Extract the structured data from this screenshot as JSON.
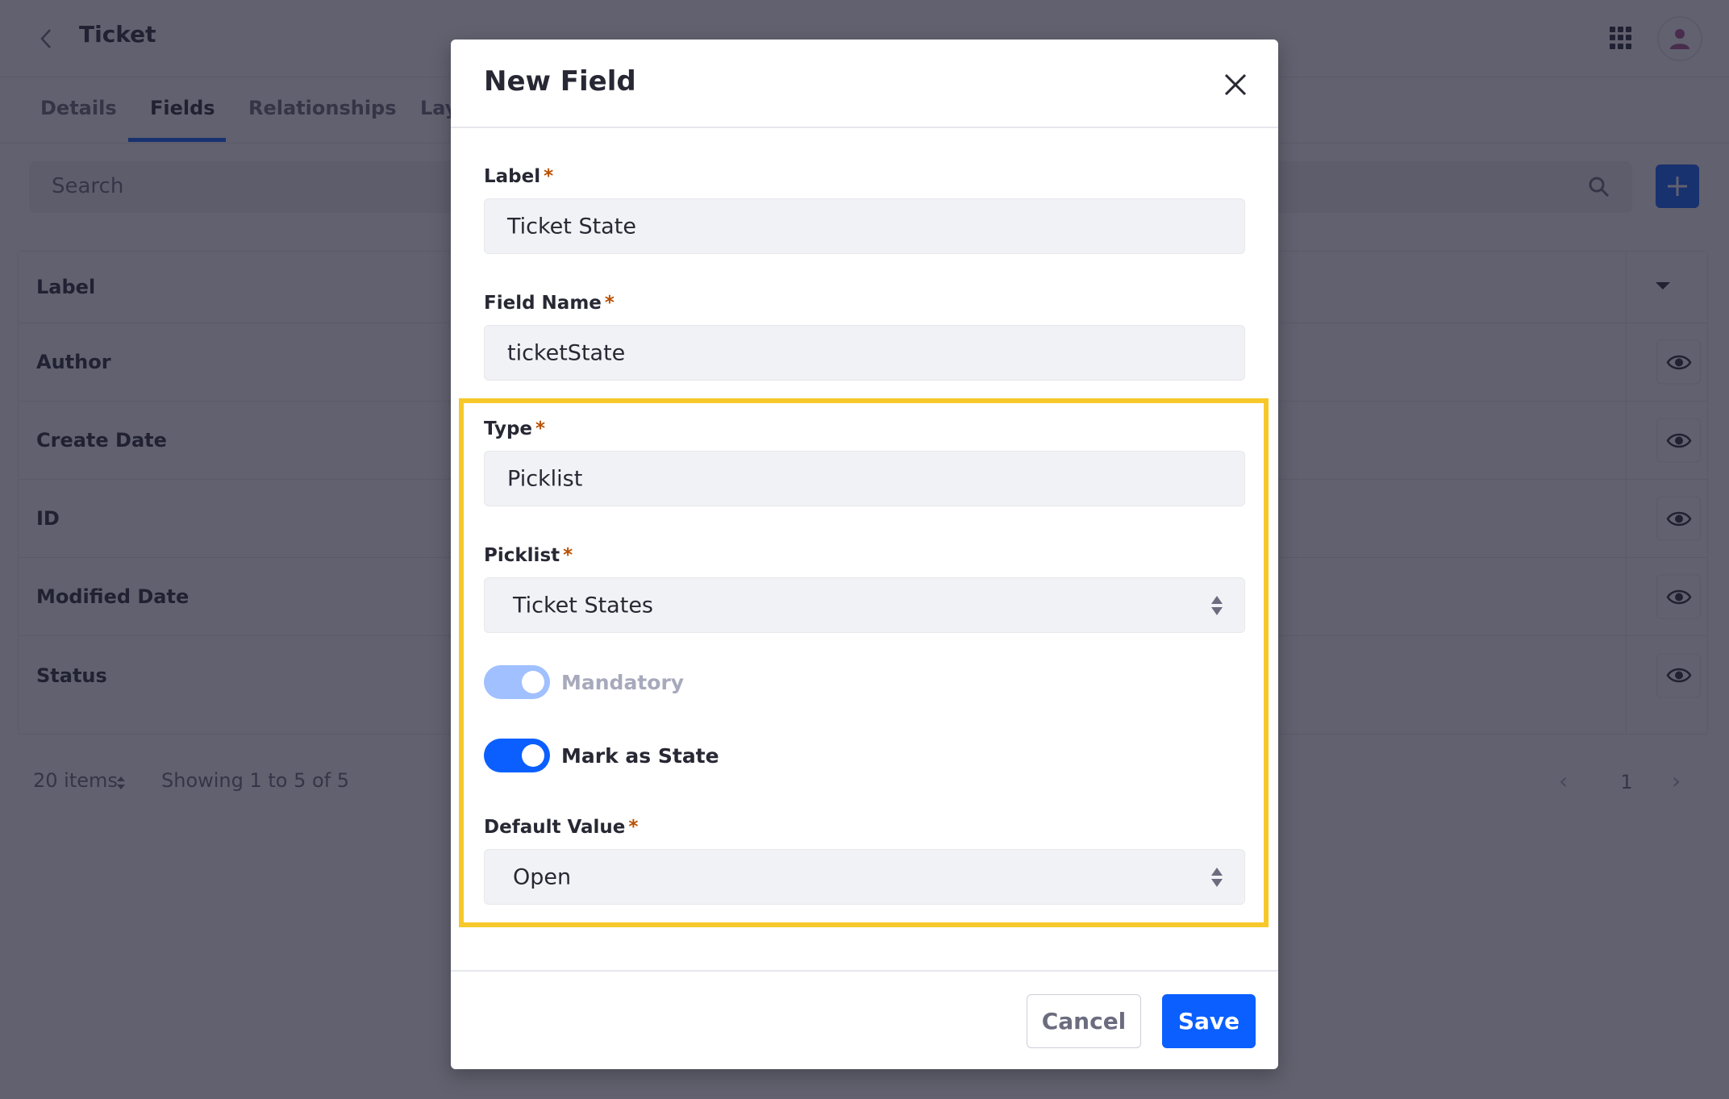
{
  "header": {
    "title": "Ticket",
    "back_label": "Back"
  },
  "tabs": [
    {
      "label": "Details",
      "active": false
    },
    {
      "label": "Fields",
      "active": true
    },
    {
      "label": "Relationships",
      "active": false
    },
    {
      "label": "Layouts",
      "active": false
    }
  ],
  "search": {
    "placeholder": "Search"
  },
  "table": {
    "header": "Label",
    "rows": [
      {
        "label": "Author"
      },
      {
        "label": "Create Date"
      },
      {
        "label": "ID"
      },
      {
        "label": "Modified Date"
      },
      {
        "label": "Status"
      }
    ]
  },
  "pagination": {
    "items_per_page": "20 items",
    "summary": "Showing 1 to 5 of 5",
    "current_page": "1",
    "prev": "‹",
    "next": "›"
  },
  "modal": {
    "title": "New Field",
    "required_marker": "*",
    "fields": {
      "label": {
        "label": "Label",
        "value": "Ticket State"
      },
      "field_name": {
        "label": "Field Name",
        "value": "ticketState"
      },
      "type": {
        "label": "Type",
        "value": "Picklist"
      },
      "picklist": {
        "label": "Picklist",
        "value": "Ticket States"
      },
      "default_value": {
        "label": "Default Value",
        "value": "Open"
      }
    },
    "toggles": {
      "mandatory": {
        "label": "Mandatory",
        "checked": true,
        "disabled": true
      },
      "mark_as_state": {
        "label": "Mark as State",
        "checked": true,
        "disabled": false
      }
    },
    "buttons": {
      "cancel": "Cancel",
      "save": "Save"
    }
  },
  "colors": {
    "primary": "#0b5fff",
    "primary_disabled": "#a0c0ff",
    "highlight": "#f6c82b",
    "required": "#b95000",
    "backdrop": "rgba(30,30,50,0.70)"
  }
}
